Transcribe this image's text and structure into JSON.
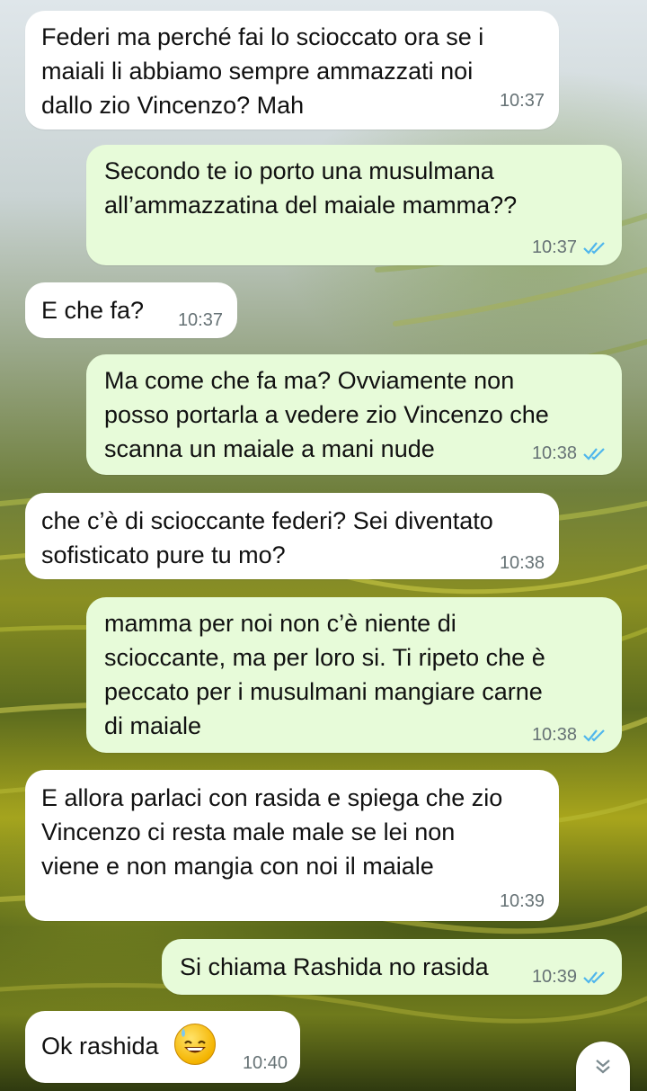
{
  "messages": [
    {
      "dir": "in",
      "text": "Federi ma perché fai lo scioccato ora se i\nmaiali li abbiamo sempre ammazzati noi\ndallo zio Vincenzo? Mah",
      "time": "10:37"
    },
    {
      "dir": "out",
      "text": "Secondo te io porto una musulmana\nall’ammazzatina del maiale mamma??",
      "time": "10:37",
      "status": "read"
    },
    {
      "dir": "in",
      "text": "E che fa?",
      "time": "10:37"
    },
    {
      "dir": "out",
      "text": "Ma come che fa ma? Ovviamente non\nposso portarla a vedere zio Vincenzo che\nscanna un maiale a mani nude",
      "time": "10:38",
      "status": "read"
    },
    {
      "dir": "in",
      "text": "che c’è di scioccante federi? Sei diventato\nsofisticato pure tu mo?",
      "time": "10:38"
    },
    {
      "dir": "out",
      "text": "mamma per noi non c’è niente di\nscioccante, ma per loro si. Ti ripeto che è\npeccato per i musulmani mangiare carne\ndi maiale",
      "time": "10:38",
      "status": "read"
    },
    {
      "dir": "in",
      "text": "E allora parlaci con rasida e spiega che zio\nVincenzo ci resta male male se lei non\nviene e non mangia con noi il maiale",
      "time": "10:39"
    },
    {
      "dir": "out",
      "text": "Si chiama Rashida no rasida",
      "time": "10:39",
      "status": "read"
    },
    {
      "dir": "in",
      "text": "Ok rashida",
      "time": "10:40",
      "emoji": "grinning-face-with-sweat-icon"
    }
  ],
  "icons": {
    "read_receipt": "double-check-icon",
    "scroll_down": "double-chevron-down-icon"
  },
  "colors": {
    "incoming_bubble": "#ffffff",
    "outgoing_bubble": "#e7fbd9",
    "read_ticks": "#4fb6ec",
    "timestamp": "#667275"
  }
}
